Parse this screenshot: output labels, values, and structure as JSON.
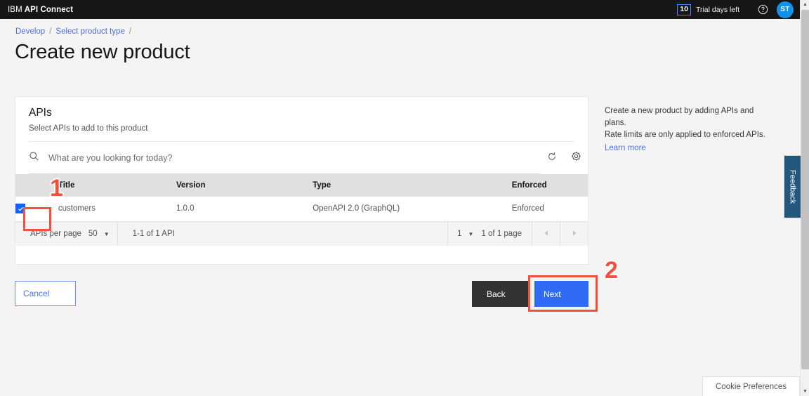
{
  "header": {
    "brand_ibm": "IBM",
    "brand_product": "API Connect",
    "trial_count": "10",
    "trial_label": "Trial days left",
    "help_icon": "help-circle-icon",
    "avatar_initials": "ST"
  },
  "breadcrumb": {
    "items": [
      {
        "label": "Develop"
      },
      {
        "label": "Select product type"
      }
    ],
    "separator": "/"
  },
  "page": {
    "title": "Create new product"
  },
  "card": {
    "title": "APIs",
    "subtitle": "Select APIs to add to this product",
    "search": {
      "placeholder": "What are you looking for today?",
      "value": "",
      "search_icon": "search-icon",
      "refresh_icon": "refresh-icon",
      "settings_icon": "gear-icon"
    },
    "table": {
      "columns": [
        "",
        "Title",
        "Version",
        "Type",
        "Enforced"
      ],
      "rows": [
        {
          "selected": true,
          "title": "customers",
          "version": "1.0.0",
          "type": "OpenAPI 2.0 (GraphQL)",
          "enforced": "Enforced"
        }
      ]
    },
    "pagination": {
      "per_page_label": "APIs per page",
      "per_page_value": "50",
      "range_label": "1-1 of 1 API",
      "page_value": "1",
      "page_label": "1 of 1 page",
      "prev_icon": "caret-left-icon",
      "next_icon": "caret-right-icon"
    }
  },
  "footer": {
    "cancel_label": "Cancel",
    "back_label": "Back",
    "next_label": "Next"
  },
  "side_help": {
    "line1": "Create a new product by adding APIs and plans.",
    "line2": "Rate limits are only applied to enforced APIs.",
    "learn_more": "Learn more"
  },
  "feedback": {
    "label": "Feedback"
  },
  "cookie": {
    "label": "Cookie Preferences"
  },
  "annotations": {
    "step1": "1",
    "step2": "2",
    "highlight_color": "#f4503c"
  }
}
